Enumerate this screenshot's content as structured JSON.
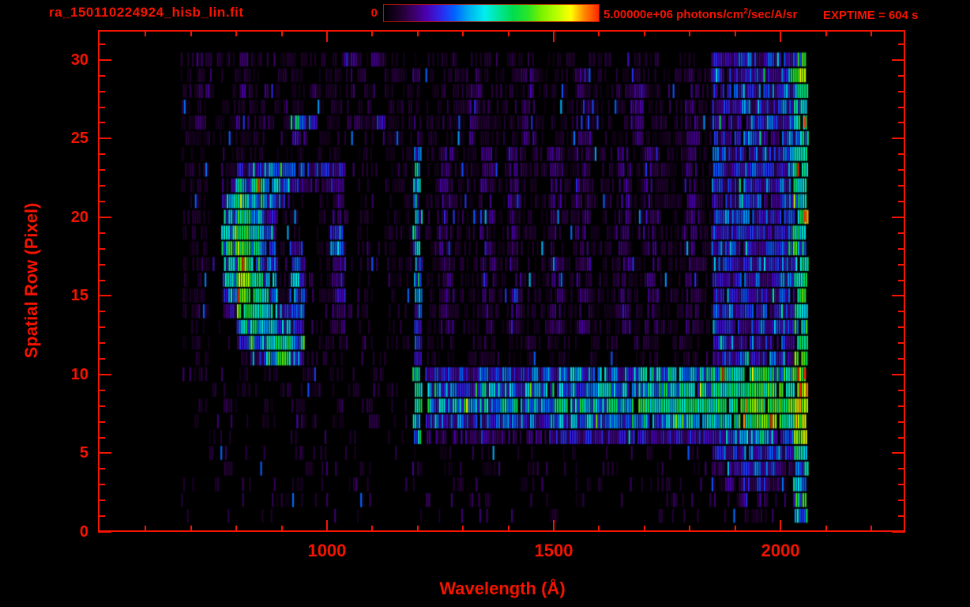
{
  "colors": {
    "accent_red": "#f51400",
    "background": "#000000"
  },
  "header": {
    "title": "ra_150110224924_hisb_lin.fit",
    "exptime": "EXPTIME = 604 s",
    "colorbar": {
      "min_label": "0",
      "max_value": "5.00000e+06",
      "units_prefix": " photons/cm",
      "sup": "2",
      "units_suffix": "/sec/A/sr"
    }
  },
  "chart_data": {
    "type": "heatmap",
    "title": "ra_150110224924_hisb_lin.fit",
    "xlabel": "Wavelength (Å)",
    "ylabel": "Spatial Row (Pixel)",
    "x_range": [
      495,
      2275
    ],
    "y_range": [
      0,
      31.9
    ],
    "x_major_ticks": [
      1000,
      1500,
      2000
    ],
    "x_minor_step": 100,
    "x_minor_range": [
      600,
      2200
    ],
    "y_major_ticks": [
      0,
      5,
      10,
      15,
      20,
      25,
      30
    ],
    "y_minor_step": 1,
    "colorbar": {
      "min": 0,
      "max": 5000000,
      "units": "photons/cm^2/sec/A/sr"
    },
    "exptime_seconds": 604,
    "colormap_stops": [
      {
        "p": 0.0,
        "c": "#000000"
      },
      {
        "p": 0.07,
        "c": "#1c0028"
      },
      {
        "p": 0.13,
        "c": "#38005e"
      },
      {
        "p": 0.2,
        "c": "#4b00b4"
      },
      {
        "p": 0.27,
        "c": "#2b2bee"
      },
      {
        "p": 0.33,
        "c": "#0064ff"
      },
      {
        "p": 0.4,
        "c": "#00b4f0"
      },
      {
        "p": 0.47,
        "c": "#00eeee"
      },
      {
        "p": 0.53,
        "c": "#00e6a0"
      },
      {
        "p": 0.6,
        "c": "#00dc50"
      },
      {
        "p": 0.67,
        "c": "#28e628"
      },
      {
        "p": 0.73,
        "c": "#78f000"
      },
      {
        "p": 0.8,
        "c": "#b4ff00"
      },
      {
        "p": 0.87,
        "c": "#ffff00"
      },
      {
        "p": 0.93,
        "c": "#ff8c00"
      },
      {
        "p": 1.0,
        "c": "#ff2800"
      }
    ],
    "grid_info": {
      "lambda_start": 680,
      "lambda_step": 30,
      "columns": 46,
      "row_order": "spatial row 30 (top) down to 1 (bottom)",
      "value_scale": "hex digit 0-f mapped linearly onto colormap 0-1",
      "segments": "left c0-c16 (17), lyman-alpha c17 (1), mid c18-c38 (21), right c39-c44 (6), edge c45 (1)"
    },
    "grid": [
      {
        "sr": 30,
        "seg": [
          "12112121121121211",
          "1",
          "110110110110110110110",
          "334343",
          "7"
        ]
      },
      {
        "sr": 29,
        "seg": [
          "11011101101101011",
          "2",
          "111211121112111211121",
          "434434",
          "b"
        ]
      },
      {
        "sr": 28,
        "seg": [
          "12112121121121211",
          "1",
          "111211121112111211121",
          "344434",
          "8"
        ]
      },
      {
        "sr": 27,
        "seg": [
          "11011101101101011",
          "1",
          "111211121112111211121",
          "334334",
          "6"
        ]
      },
      {
        "sr": 26,
        "seg": [
          "12112121431121211",
          "2",
          "111211121112111211121",
          "434343",
          "8"
        ]
      },
      {
        "sr": 25,
        "seg": [
          "11011101301101011",
          "2",
          "111211121112111211121",
          "334434",
          "7"
        ]
      },
      {
        "sr": 24,
        "seg": [
          "11011101101101011",
          "5",
          "121121211212112121121",
          "434334",
          "8"
        ]
      },
      {
        "sr": 23,
        "seg": [
          "11013555433301011",
          "6",
          "121121211212112121121",
          "434434",
          "9"
        ]
      },
      {
        "sr": 22,
        "seg": [
          "11026765322301011",
          "6",
          "121121211212112121121",
          "434344",
          "8"
        ]
      },
      {
        "sr": 21,
        "seg": [
          "11058754101201011",
          "5",
          "121121211212112121121",
          "434434",
          "7"
        ]
      },
      {
        "sr": 20,
        "seg": [
          "11069631101201011",
          "5",
          "121121211212112121121",
          "444434",
          "8"
        ]
      },
      {
        "sr": 19,
        "seg": [
          "1107a641101401011",
          "6",
          "121121211212112121121",
          "434434",
          "8"
        ]
      },
      {
        "sr": 18,
        "seg": [
          "1107b741301401011",
          "5",
          "121121211212112121121",
          "434344",
          "7"
        ]
      },
      {
        "sr": 17,
        "seg": [
          "1106b741401301011",
          "5",
          "121121211212112121121",
          "334434",
          "8"
        ]
      },
      {
        "sr": 16,
        "seg": [
          "1106c851501301011",
          "5",
          "121121211212112121121",
          "434434",
          "9"
        ]
      },
      {
        "sr": 15,
        "seg": [
          "1105c851501301011",
          "5",
          "121121211212112121121",
          "434344",
          "8"
        ]
      },
      {
        "sr": 14,
        "seg": [
          "1103a864401201011",
          "5",
          "121121211212112121121",
          "434434",
          "8"
        ]
      },
      {
        "sr": 13,
        "seg": [
          "11007765301201011",
          "4",
          "121121211212112121121",
          "334434",
          "7"
        ]
      },
      {
        "sr": 12,
        "seg": [
          "11004678501101011",
          "4",
          "110110110110110110110",
          "434334",
          "8"
        ]
      },
      {
        "sr": 11,
        "seg": [
          "01001369410100100",
          "4",
          "110110110110110110110",
          "334343",
          "9"
        ]
      },
      {
        "sr": 10,
        "seg": [
          "01001010010100100",
          "7",
          "444444444555555566666",
          "788877",
          "a"
        ]
      },
      {
        "sr": 9,
        "seg": [
          "00101001010010010",
          "8",
          "555555555666666677777",
          "8899a9",
          "c"
        ]
      },
      {
        "sr": 8,
        "seg": [
          "01010010100101000",
          "8",
          "666666666777777788888",
          "99aaba",
          "c"
        ]
      },
      {
        "sr": 7,
        "seg": [
          "01001010010100100",
          "6",
          "444444444555555566666",
          "789ab9",
          "d"
        ]
      },
      {
        "sr": 6,
        "seg": [
          "00100000100010000",
          "5",
          "222222222333333333333",
          "456654",
          "b"
        ]
      },
      {
        "sr": 5,
        "seg": [
          "00100000100010000",
          "1",
          "010010010010010010010",
          "334453",
          "8"
        ]
      },
      {
        "sr": 4,
        "seg": [
          "00010000010001000",
          "1",
          "010010010010010010010",
          "233432",
          "6"
        ]
      },
      {
        "sr": 3,
        "seg": [
          "00100000100010000",
          "0",
          "001000010000100001000",
          "123321",
          "5"
        ]
      },
      {
        "sr": 2,
        "seg": [
          "00000001000000000",
          "0",
          "000010000001000000100",
          "012210",
          "7"
        ]
      },
      {
        "sr": 1,
        "seg": [
          "00000000000000000",
          "0",
          "000000000100000000000",
          "001100",
          "7"
        ]
      }
    ],
    "red_speck_rows": [
      26,
      20,
      10
    ],
    "red_speck_lambda": 2052,
    "features": [
      "C-shaped airglow arc, lambda 770-950 Å, rows 11-23, brightest yellow-green edge at 800-830 Å rows 14-19",
      "faint Lyman-beta vertical line near 1026 Å, rows 13-22",
      "bright Lyman-alpha vertical line near 1200-1216 Å, rows 6-24, green core at rows 8-10",
      "horizontal continuum band rows 7-10 from 1200 to 2060 Å, brightening blue->cyan->green toward long wavelengths",
      "bright long-wavelength edge 1940-2065 Å over rows 1-30, green/yellow column near 2030-2060 Å",
      "sparse dark noise rows 0-5, detector noise stripes elsewhere"
    ]
  }
}
